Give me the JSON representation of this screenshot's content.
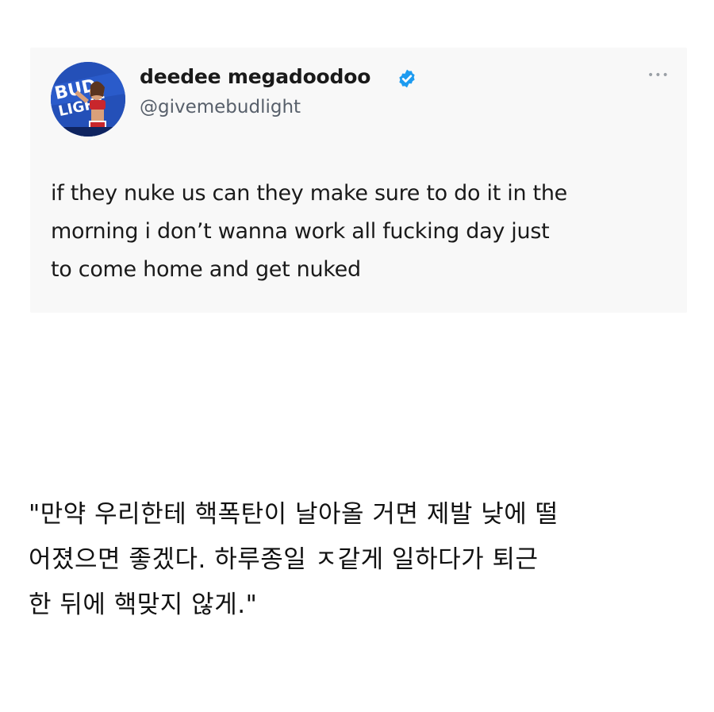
{
  "tweet": {
    "display_name": "deedee megadoodoo",
    "handle": "@givemebudlight",
    "verified_icon": "verified-badge-icon",
    "more_icon": "more-options-icon",
    "more_glyph": "•••",
    "text_lines": [
      "if they nuke us can they make sure to do it in the",
      "morning i don’t wanna work all fucking day just",
      "to come home and get nuked"
    ],
    "avatar_icon": "profile-avatar",
    "colors": {
      "verified": "#1d9bf0",
      "handle": "#58606b",
      "card_bg": "#f8f8f8"
    }
  },
  "translation": {
    "lines": [
      "\"만약 우리한테 핵폭탄이 날아올 거면 제발 낮에 떨",
      "어졌으면 좋겠다. 하루종일 ㅈ같게 일하다가 퇴근",
      "한 뒤에 핵맞지 않게.\""
    ]
  }
}
